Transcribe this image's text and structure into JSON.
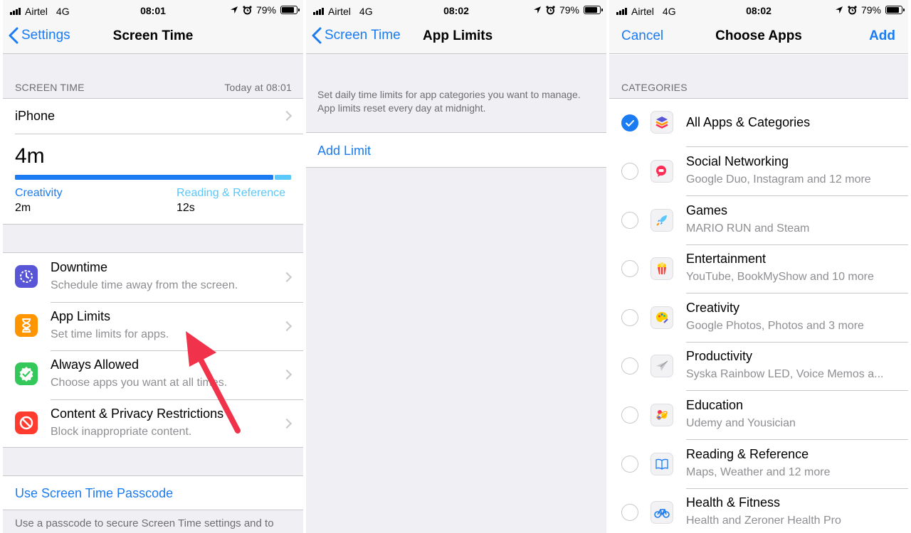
{
  "panel1": {
    "status": {
      "carrier": "Airtel",
      "network": "4G",
      "time": "08:01",
      "battery": "79%"
    },
    "nav": {
      "back_label": "Settings",
      "title": "Screen Time"
    },
    "section_header": "SCREEN TIME",
    "section_header_right": "Today at 08:01",
    "device_row": "iPhone",
    "total_time": "4m",
    "usage_bar": {
      "primary_fraction": 0.936,
      "primary_color": "#1a7bf2",
      "secondary_color": "#5ac8fa"
    },
    "categories": [
      {
        "name": "Creativity",
        "time": "2m",
        "color": "#1a7bf2"
      },
      {
        "name": "Reading & Reference",
        "time": "12s",
        "color": "#5ac8fa"
      }
    ],
    "items": [
      {
        "title": "Downtime",
        "subtitle": "Schedule time away from the screen.",
        "icon": "downtime-icon",
        "color": "#5856d6"
      },
      {
        "title": "App Limits",
        "subtitle": "Set time limits for apps.",
        "icon": "hourglass-icon",
        "color": "#ff9500"
      },
      {
        "title": "Always Allowed",
        "subtitle": "Choose apps you want at all times.",
        "icon": "check-badge-icon",
        "color": "#34c759"
      },
      {
        "title": "Content & Privacy Restrictions",
        "subtitle": "Block inappropriate content.",
        "icon": "no-entry-icon",
        "color": "#ff3b30"
      }
    ],
    "passcode_link": "Use Screen Time Passcode",
    "passcode_footer": "Use a passcode to secure Screen Time settings and to"
  },
  "panel2": {
    "status": {
      "carrier": "Airtel",
      "network": "4G",
      "time": "08:02",
      "battery": "79%"
    },
    "nav": {
      "back_label": "Screen Time",
      "title": "App Limits"
    },
    "description": "Set daily time limits for app categories you want to manage. App limits reset every day at midnight.",
    "add_limit": "Add Limit"
  },
  "panel3": {
    "status": {
      "carrier": "Airtel",
      "network": "4G",
      "time": "08:02",
      "battery": "79%"
    },
    "nav": {
      "cancel_label": "Cancel",
      "title": "Choose Apps",
      "add_label": "Add"
    },
    "section_header": "CATEGORIES",
    "all_apps": {
      "title": "All Apps & Categories",
      "checked": true
    },
    "categories": [
      {
        "title": "Social Networking",
        "subtitle": "Google Duo, Instagram and 12 more",
        "icon": "speech-bubble-icon"
      },
      {
        "title": "Games",
        "subtitle": "MARIO RUN and Steam",
        "icon": "rocket-icon"
      },
      {
        "title": "Entertainment",
        "subtitle": "YouTube, BookMyShow and 10 more",
        "icon": "popcorn-icon"
      },
      {
        "title": "Creativity",
        "subtitle": "Google Photos, Photos and 3 more",
        "icon": "palette-icon"
      },
      {
        "title": "Productivity",
        "subtitle": "Syska Rainbow LED, Voice Memos a...",
        "icon": "paper-plane-icon"
      },
      {
        "title": "Education",
        "subtitle": "Udemy and Yousician",
        "icon": "atom-icon"
      },
      {
        "title": "Reading & Reference",
        "subtitle": "Maps, Weather and 12 more",
        "icon": "book-icon"
      },
      {
        "title": "Health & Fitness",
        "subtitle": "Health and Zeroner Health Pro",
        "icon": "bicycle-icon"
      }
    ]
  },
  "annotation": {
    "type": "red-arrow",
    "color": "#f0334b"
  }
}
